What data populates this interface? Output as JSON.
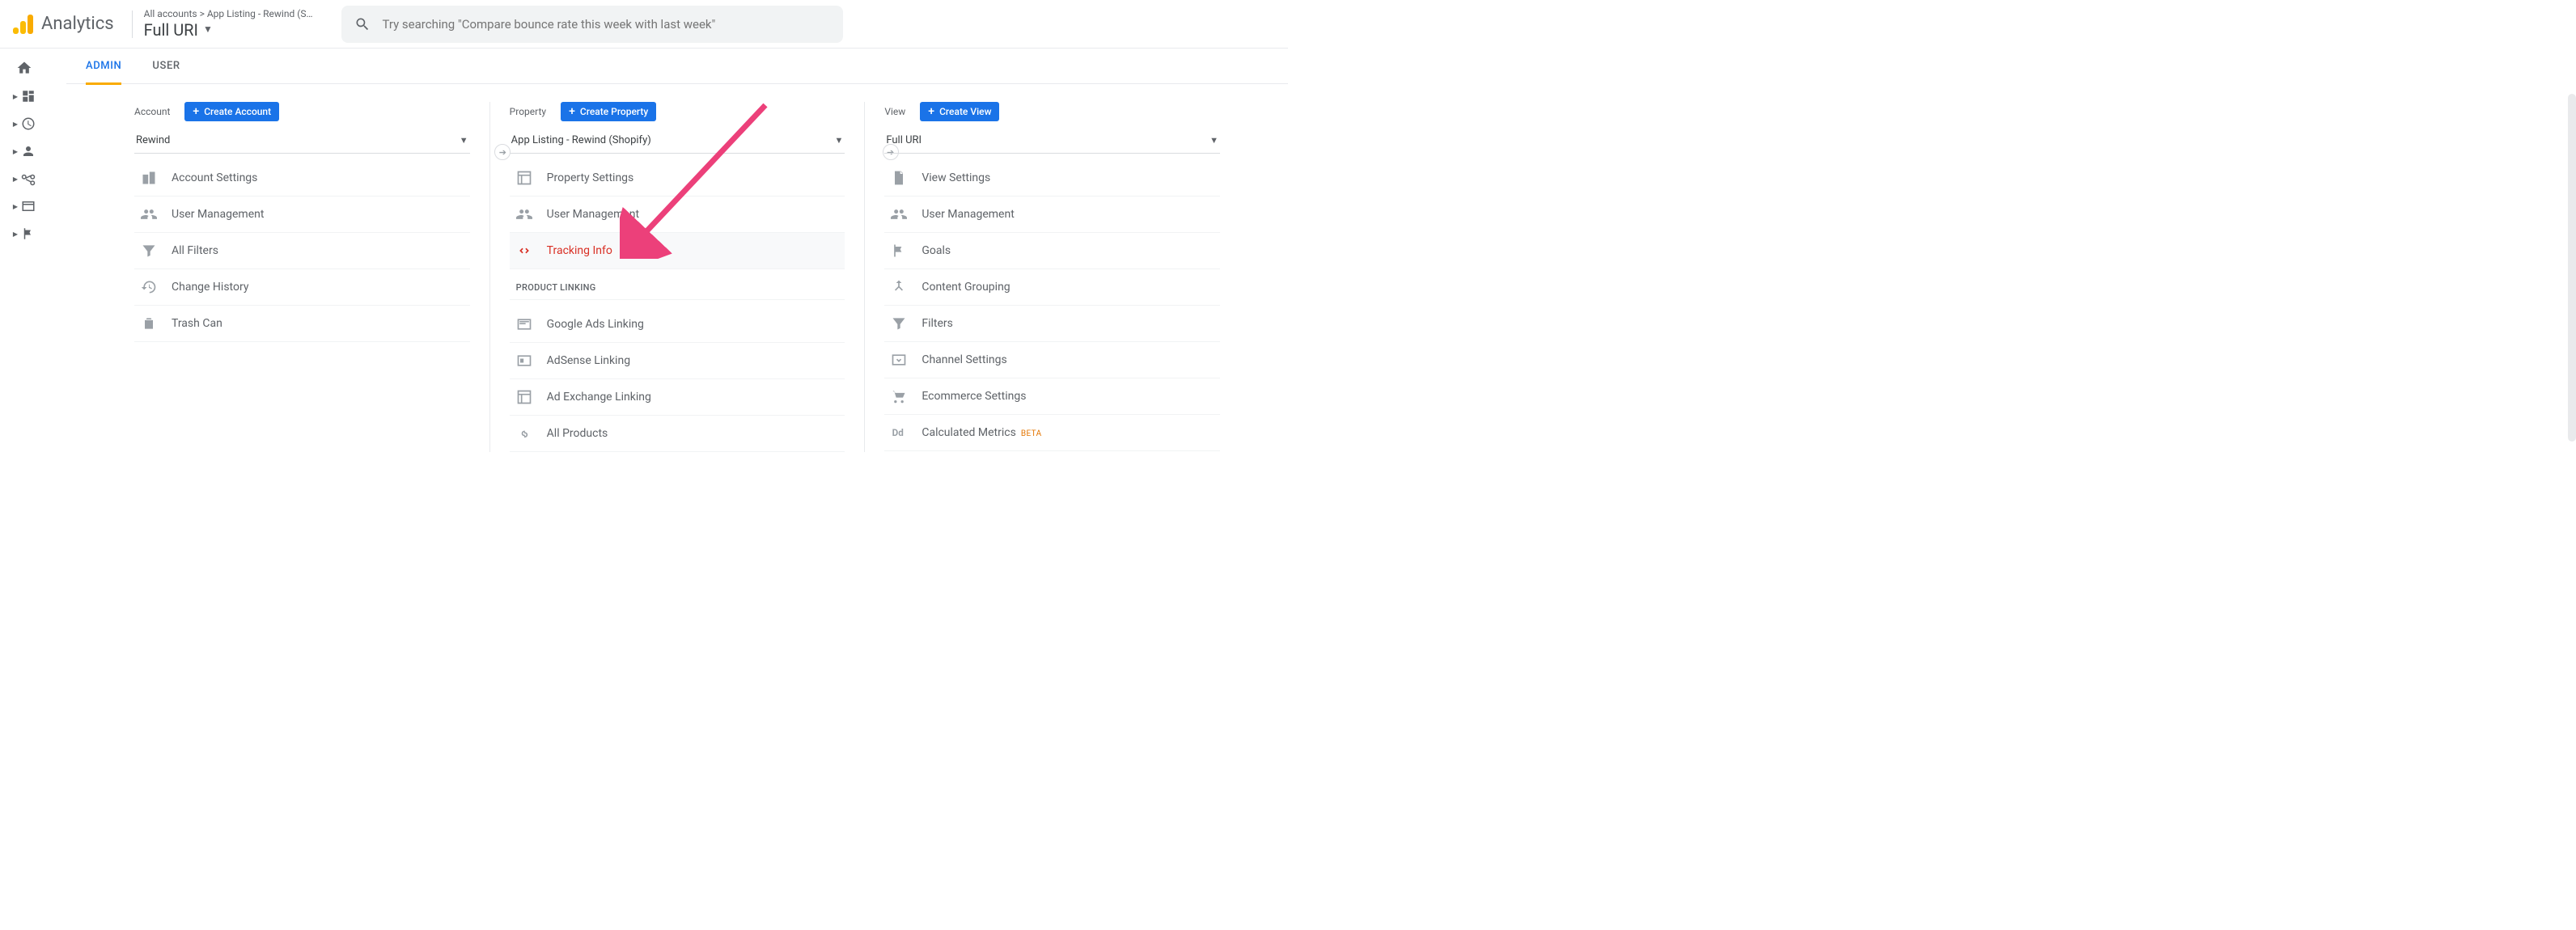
{
  "brand": {
    "name": "Analytics"
  },
  "breadcrumb": {
    "path": "All accounts > App Listing - Rewind (S…",
    "current": "Full URI"
  },
  "search": {
    "placeholder": "Try searching \"Compare bounce rate this week with last week\""
  },
  "tabs": {
    "admin": "ADMIN",
    "user": "USER"
  },
  "account": {
    "label": "Account",
    "create": "Create Account",
    "selected": "Rewind",
    "items": [
      {
        "label": "Account Settings"
      },
      {
        "label": "User Management"
      },
      {
        "label": "All Filters"
      },
      {
        "label": "Change History"
      },
      {
        "label": "Trash Can"
      }
    ]
  },
  "property": {
    "label": "Property",
    "create": "Create Property",
    "selected": "App Listing - Rewind (Shopify)",
    "items": [
      {
        "label": "Property Settings"
      },
      {
        "label": "User Management"
      },
      {
        "label": "Tracking Info"
      }
    ],
    "group_title": "PRODUCT LINKING",
    "group_items": [
      {
        "label": "Google Ads Linking"
      },
      {
        "label": "AdSense Linking"
      },
      {
        "label": "Ad Exchange Linking"
      },
      {
        "label": "All Products"
      }
    ]
  },
  "view": {
    "label": "View",
    "create": "Create View",
    "selected": "Full URI",
    "items": [
      {
        "label": "View Settings"
      },
      {
        "label": "User Management"
      },
      {
        "label": "Goals"
      },
      {
        "label": "Content Grouping"
      },
      {
        "label": "Filters"
      },
      {
        "label": "Channel Settings"
      },
      {
        "label": "Ecommerce Settings"
      },
      {
        "label": "Calculated Metrics",
        "badge": "BETA"
      }
    ]
  }
}
